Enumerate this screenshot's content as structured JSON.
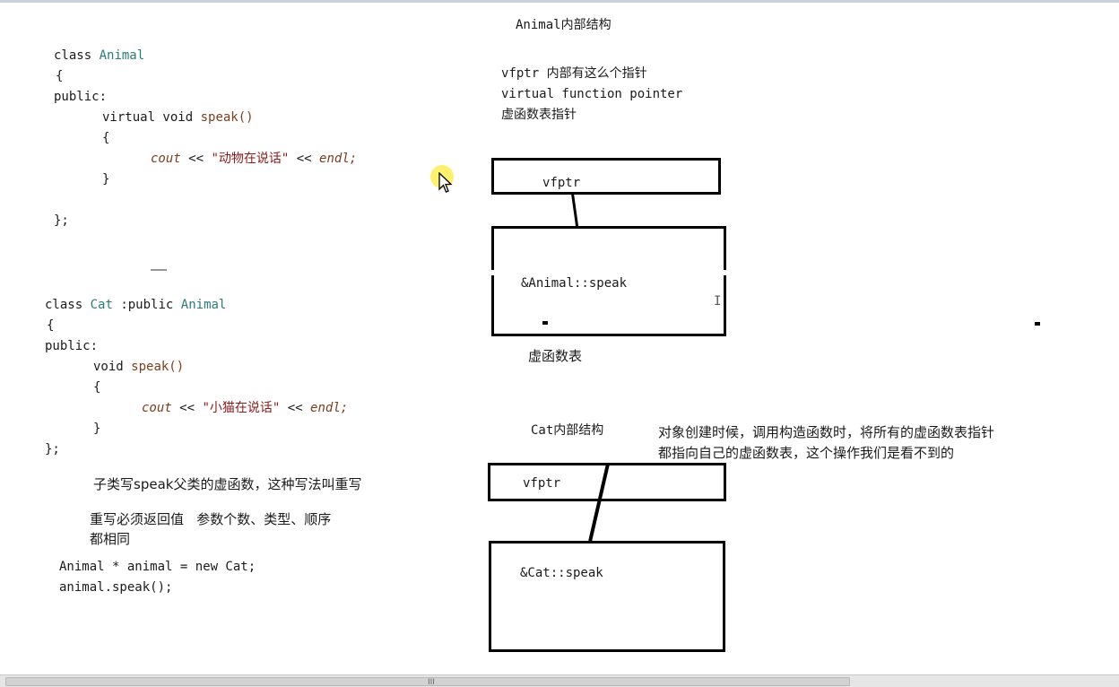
{
  "animal_title": "Animal内部结构",
  "vfptr_note": {
    "line1": "vfptr 内部有这么个指针",
    "line2": "virtual function pointer",
    "line3": "虚函数表指针"
  },
  "animal_code": {
    "l1_kw": "class",
    "l1_type": "Animal",
    "l2": "{",
    "l3": "public:",
    "l4_kw": "virtual void",
    "l4_fn": "speak()",
    "l5": "{",
    "l6_fn": "cout",
    "l6_op1": "<<",
    "l6_str": "\"动物在说话\"",
    "l6_op2": "<<",
    "l6_end": "endl;",
    "l7": "}",
    "l8": "};"
  },
  "cat_code": {
    "l1_kw": "class",
    "l1_type": "Cat",
    "l1_mid": ":public",
    "l1_base": "Animal",
    "l2": "{",
    "l3": "public:",
    "l4_kw": "void",
    "l4_fn": "speak()",
    "l5": "{",
    "l6_fn": "cout",
    "l6_op1": "<<",
    "l6_str": "\"小猫在说话\"",
    "l6_op2": "<<",
    "l6_end": "endl;",
    "l7": "}",
    "l8": "};"
  },
  "note_override": "子类写speak父类的虚函数，这种写法叫重写",
  "note_rules": {
    "line1": "重写必须返回值   参数个数、类型、顺序",
    "line2": "都相同"
  },
  "usage": {
    "line1": "Animal * animal = new Cat;",
    "line2": "animal.speak();"
  },
  "animal_diagram": {
    "vfptr_label": "vfptr",
    "entry_label": "&Animal::speak",
    "table_caption": "虚函数表"
  },
  "cat_title": "Cat内部结构",
  "cat_note": {
    "line1": "对象创建时候，调用构造函数时，将所有的虚函数表指针",
    "line2": "都指向自己的虚函数表，这个操作我们是看不到的"
  },
  "cat_diagram": {
    "vfptr_label": "vfptr",
    "entry_label": "&Cat::speak"
  },
  "text_cursor_glyph": "I",
  "scroll_grip": "III"
}
